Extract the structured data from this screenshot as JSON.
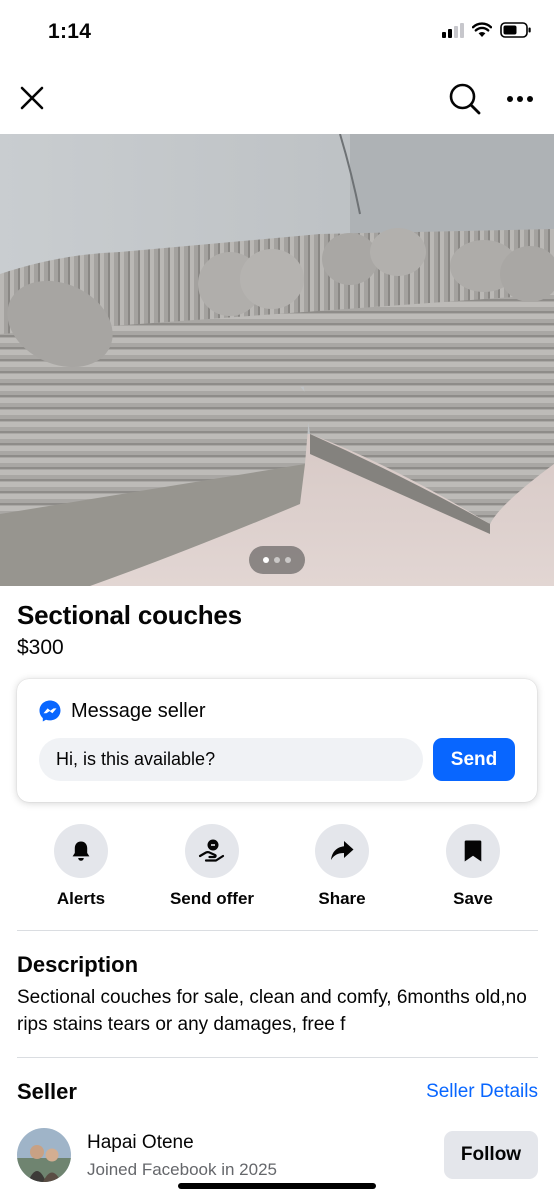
{
  "status_bar": {
    "time": "1:14"
  },
  "nav": {
    "close_icon": "close-icon",
    "search_icon": "search-icon",
    "more_icon": "more-icon"
  },
  "photo": {
    "description_icon": "photo",
    "carousel": {
      "count": 3,
      "active_index": 0
    }
  },
  "listing": {
    "title": "Sectional couches",
    "price": "$300"
  },
  "message_card": {
    "title": "Message seller",
    "input_value": "Hi, is this available?",
    "send_label": "Send"
  },
  "actions": [
    {
      "label": "Alerts",
      "icon": "bell-icon"
    },
    {
      "label": "Send offer",
      "icon": "offer-icon"
    },
    {
      "label": "Share",
      "icon": "share-icon"
    },
    {
      "label": "Save",
      "icon": "bookmark-icon"
    }
  ],
  "description": {
    "heading": "Description",
    "text": "Sectional couches for sale, clean and comfy, 6months old,no rips stains tears or any damages, free f"
  },
  "seller": {
    "heading": "Seller",
    "details_link": "Seller Details",
    "name": "Hapai Otene",
    "joined": "Joined Facebook in 2025",
    "follow_label": "Follow"
  },
  "colors": {
    "accent": "#0866ff",
    "chip_bg": "#e4e6eb",
    "input_bg": "#f0f2f5",
    "secondary_text": "#65676b"
  }
}
